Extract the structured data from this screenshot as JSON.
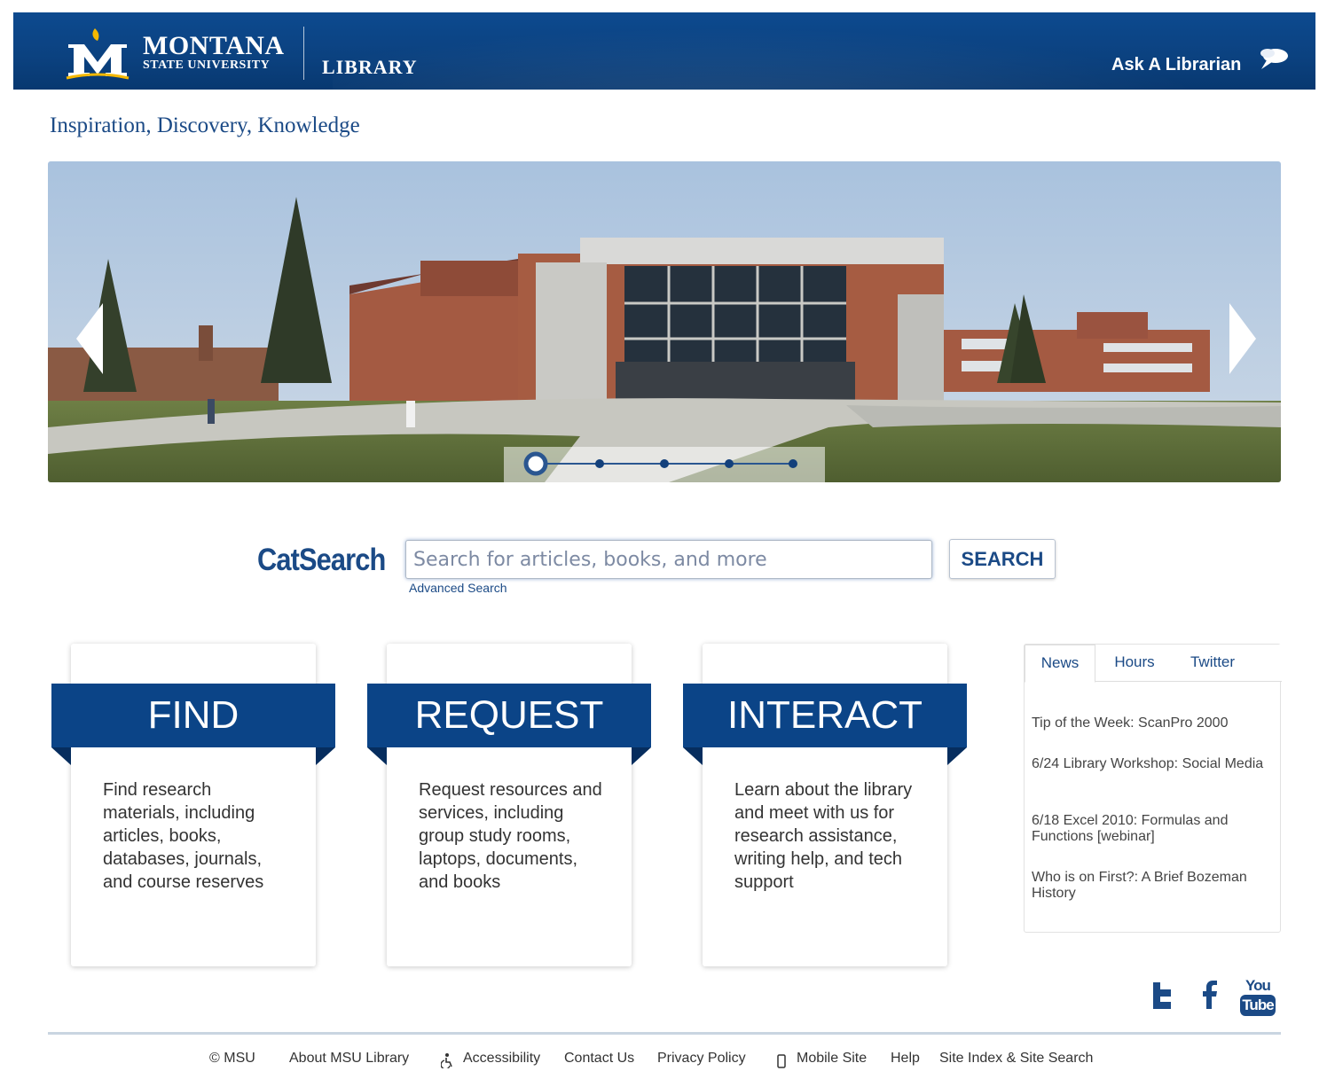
{
  "header": {
    "university_line1": "MONTANA",
    "university_line2": "STATE UNIVERSITY",
    "library_label": "LIBRARY",
    "ask_link": "Ask A Librarian",
    "colors": {
      "brand_blue": "#0b4487",
      "gold": "#f5b800"
    }
  },
  "tagline": "Inspiration, Discovery, Knowledge",
  "carousel": {
    "slide_count": 5,
    "active_slide": 1,
    "prev_icon": "chevron-left-icon",
    "next_icon": "chevron-right-icon"
  },
  "search": {
    "label": "CatSearch",
    "placeholder": "Search for articles, books, and more",
    "value": "",
    "button": "SEARCH",
    "advanced_link": "Advanced Search"
  },
  "cards": [
    {
      "title": "FIND",
      "text": "Find research materials, including articles, books, databases, journals, and course reserves"
    },
    {
      "title": "REQUEST",
      "text": "Request resources and services, including group study rooms, laptops, documents, and books"
    },
    {
      "title": "INTERACT",
      "text": "Learn about the library and meet with us for research assistance, writing help, and tech support"
    }
  ],
  "tabs": {
    "labels": [
      "News",
      "Hours",
      "Twitter"
    ],
    "active": "News",
    "news": [
      "Tip of the Week: ScanPro 2000",
      "6/24 Library Workshop: Social Media",
      "6/18 Excel 2010: Formulas and Functions [webinar]",
      "Who is on First?: A Brief Bozeman History"
    ]
  },
  "social": {
    "icons": [
      "twitter-icon",
      "facebook-icon",
      "youtube-icon"
    ],
    "youtube_line1": "You",
    "youtube_line2": "Tube"
  },
  "footer": {
    "copyright": "© MSU",
    "links": [
      "About MSU Library",
      "Accessibility",
      "Contact Us",
      "Privacy Policy",
      "Mobile Site",
      "Help",
      "Site Index & Site Search"
    ]
  }
}
